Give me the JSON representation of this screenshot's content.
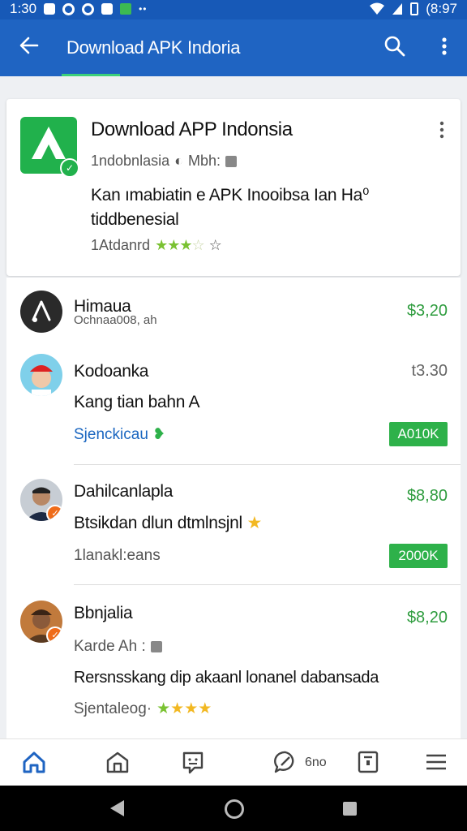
{
  "status_bar": {
    "time": "1:30",
    "battery_text": "(8:97"
  },
  "app_bar": {
    "title": "Download APK Indoria"
  },
  "featured_app": {
    "name": "Download APP Indonsia",
    "meta_left": "1ndobnlasia",
    "meta_right": "Mbh:",
    "description": "Kan ımabiatin e APK Inooibsa Ian Ha⁰ tiddbenesial",
    "rating_label": "1Atdanrd",
    "rating_stars": 3,
    "rating_stars_total": 4
  },
  "reviews": [
    {
      "name": "Himaua",
      "subtitle": "Ochnaa008, ah",
      "price": "$3,20",
      "avatar": "dark-logo"
    },
    {
      "name": "Kodoanka",
      "price": "t3.30",
      "text": "Kang tian bahn A",
      "link": "Sjenckicau",
      "button": "A010K",
      "avatar": "man-red-hat"
    },
    {
      "name": "Dahilcanlapla",
      "price": "$8,80",
      "text": "Btsikdan dlun dtmlnsjnl",
      "meta": "1lanakl:eans",
      "button": "2000K",
      "avatar": "man-suit"
    },
    {
      "name": "Bbnjalia",
      "price": "$8,20",
      "meta_left": "Karde Ah :",
      "text": "Rersnsskang dip akaanl lonanel dabansada",
      "footer": "Sjentaleog·",
      "rating_stars": 4,
      "avatar": "man-orange"
    }
  ],
  "bottom_nav": {
    "chat_label": "6no"
  },
  "colors": {
    "primary": "#1f64c2",
    "accent_green": "#2eb14a",
    "price_green": "#2e9c3e",
    "star_green": "#7ac232",
    "star_gold": "#f2b822"
  }
}
